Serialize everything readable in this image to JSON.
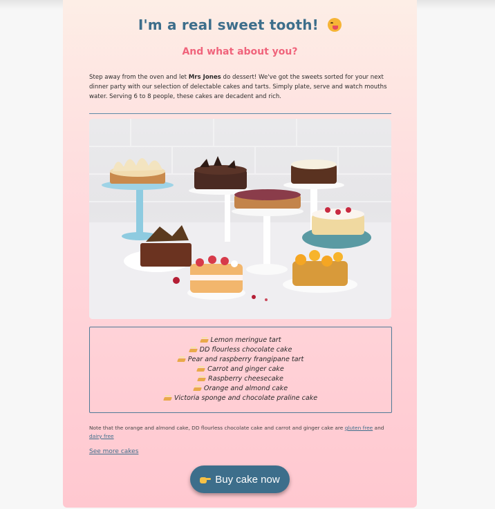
{
  "header": {
    "title": "I'm a real sweet tooth!",
    "title_emoji": "face-savoring-food-icon",
    "subtitle": "And what about you?"
  },
  "intro": {
    "before_name": "Step away from the oven and let ",
    "brand": "Mrs Jones",
    "after_name": " do dessert! We've got the sweets sorted for your next dinner party with our selection of delectable cakes and tarts. Simply plate, serve and watch mouths water. Serving 6 to 8 people, these cakes are decadent and rich."
  },
  "photo": {
    "description_icon": "cakes-photo"
  },
  "menu": {
    "icon": "cake-slice-icon",
    "items": [
      "Lemon meringue tart",
      "DD flourless chocolate cake",
      "Pear and raspberry frangipane tart",
      "Carrot and ginger cake",
      "Raspberry cheesecake",
      "Orange and almond cake",
      "Victoria sponge and chocolate praline cake"
    ]
  },
  "note": {
    "text": "Note that the orange and almond cake, DD flourless chocolate cake and carrot and ginger cake are ",
    "link1": "gluten free",
    "joiner": " and ",
    "link2": "dairy free"
  },
  "links": {
    "see_more": "See more cakes"
  },
  "cta": {
    "label": "Buy cake now",
    "icon": "pointing-hand-icon"
  },
  "colors": {
    "accent": "#3d6e8b",
    "subtitle": "#f0647c",
    "card_top": "#fdeee6",
    "card_bottom": "#ffc8d0"
  }
}
